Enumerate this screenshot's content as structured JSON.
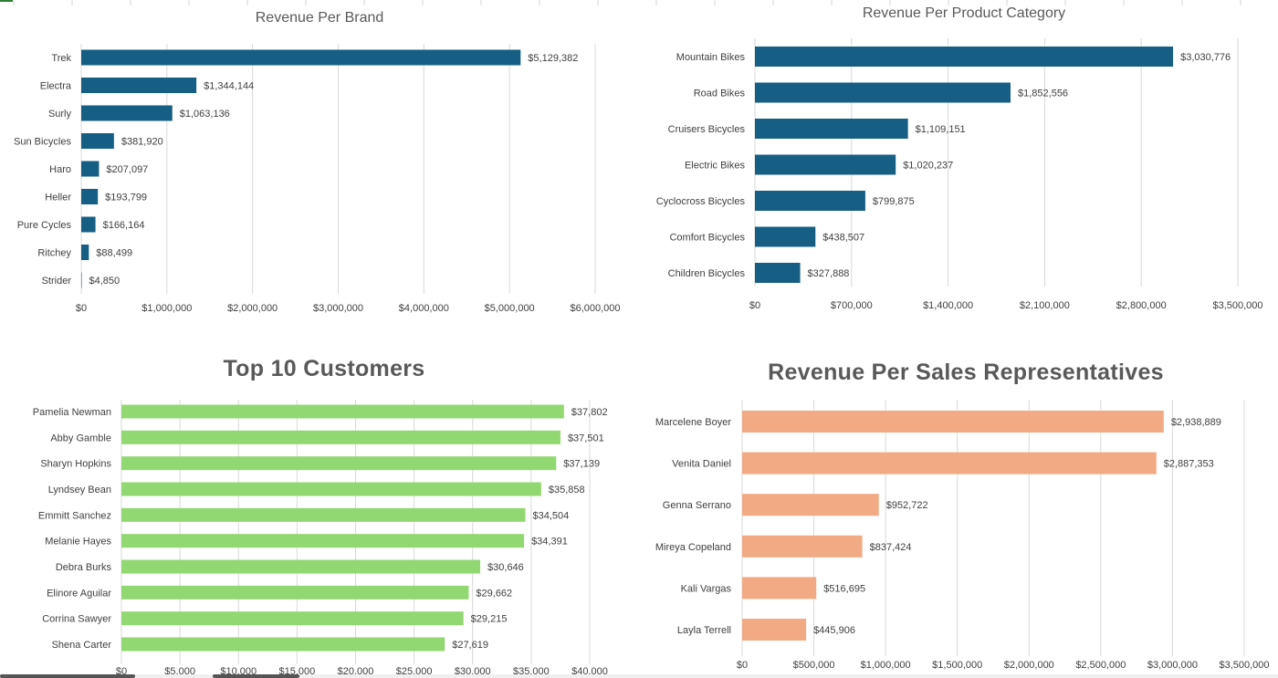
{
  "chart_data": [
    {
      "id": "brand",
      "type": "bar",
      "title": "Revenue Per Brand",
      "categories": [
        "Trek",
        "Electra",
        "Surly",
        "Sun Bicycles",
        "Haro",
        "Heller",
        "Pure Cycles",
        "Ritchey",
        "Strider"
      ],
      "values": [
        5129382,
        1344144,
        1063136,
        381920,
        207097,
        193799,
        166164,
        88499,
        4850
      ],
      "value_labels": [
        "$5,129,382",
        "$1,344,144",
        "$1,063,136",
        "$381,920",
        "$207,097",
        "$193,799",
        "$166,164",
        "$88,499",
        "$4,850"
      ],
      "xlim": [
        0,
        6000000
      ],
      "x_ticks": [
        0,
        1000000,
        2000000,
        3000000,
        4000000,
        5000000,
        6000000
      ],
      "x_tick_labels": [
        "$0",
        "$1,000,000",
        "$2,000,000",
        "$3,000,000",
        "$4,000,000",
        "$5,000,000",
        "$6,000,000"
      ],
      "color": "#165e83",
      "grid": true,
      "orientation": "horizontal"
    },
    {
      "id": "category",
      "type": "bar",
      "title": "Revenue Per Product Category",
      "categories": [
        "Mountain Bikes",
        "Road Bikes",
        "Cruisers Bicycles",
        "Electric Bikes",
        "Cyclocross Bicycles",
        "Comfort Bicycles",
        "Children Bicycles"
      ],
      "values": [
        3030776,
        1852556,
        1109151,
        1020237,
        799875,
        438507,
        327888
      ],
      "value_labels": [
        "$3,030,776",
        "$1,852,556",
        "$1,109,151",
        "$1,020,237",
        "$799,875",
        "$438,507",
        "$327,888"
      ],
      "xlim": [
        0,
        3500000
      ],
      "x_ticks": [
        0,
        700000,
        1400000,
        2100000,
        2800000,
        3500000
      ],
      "x_tick_labels": [
        "$0",
        "$700,000",
        "$1,400,000",
        "$2,100,000",
        "$2,800,000",
        "$3,500,000"
      ],
      "color": "#165e83",
      "grid": true,
      "orientation": "horizontal"
    },
    {
      "id": "customers",
      "type": "bar",
      "title": "Top 10 Customers",
      "categories": [
        "Pamelia Newman",
        "Abby Gamble",
        "Sharyn Hopkins",
        "Lyndsey Bean",
        "Emmitt Sanchez",
        "Melanie Hayes",
        "Debra Burks",
        "Elinore Aguilar",
        "Corrina Sawyer",
        "Shena Carter"
      ],
      "values": [
        37802,
        37501,
        37139,
        35858,
        34504,
        34391,
        30646,
        29662,
        29215,
        27619
      ],
      "value_labels": [
        "$37,802",
        "$37,501",
        "$37,139",
        "$35,858",
        "$34,504",
        "$34,391",
        "$30,646",
        "$29,662",
        "$29,215",
        "$27,619"
      ],
      "xlim": [
        0,
        40000
      ],
      "x_ticks": [
        0,
        5000,
        10000,
        15000,
        20000,
        25000,
        30000,
        35000,
        40000
      ],
      "x_tick_labels": [
        "$0",
        "$5,000",
        "$10,000",
        "$15,000",
        "$20,000",
        "$25,000",
        "$30,000",
        "$35,000",
        "$40,000"
      ],
      "color": "#92d872",
      "grid": true,
      "orientation": "horizontal"
    },
    {
      "id": "reps",
      "type": "bar",
      "title": "Revenue Per Sales Representatives",
      "categories": [
        "Marcelene Boyer",
        "Venita Daniel",
        "Genna Serrano",
        "Mireya Copeland",
        "Kali Vargas",
        "Layla Terrell"
      ],
      "values": [
        2938889,
        2887353,
        952722,
        837424,
        516695,
        445906
      ],
      "value_labels": [
        "$2,938,889",
        "$2,887,353",
        "$952,722",
        "$837,424",
        "$516,695",
        "$445,906"
      ],
      "xlim": [
        0,
        3500000
      ],
      "x_ticks": [
        0,
        500000,
        1000000,
        1500000,
        2000000,
        2500000,
        3000000,
        3500000
      ],
      "x_tick_labels": [
        "$0",
        "$500,000",
        "$1,000,000",
        "$1,500,000",
        "$2,000,000",
        "$2,500,000",
        "$3,000,000",
        "$3,500,000"
      ],
      "color": "#f2aa84",
      "grid": true,
      "orientation": "horizontal"
    }
  ],
  "colors": {
    "brand_bar": "#165e83",
    "customer_bar": "#92d872",
    "rep_bar": "#f2aa84",
    "text": "#404040",
    "title": "#595959",
    "gridline": "#d9d9d9"
  }
}
